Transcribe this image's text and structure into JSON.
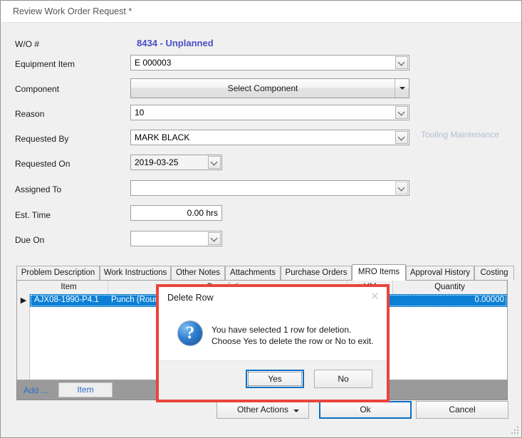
{
  "window": {
    "title": "Review Work Order Request *"
  },
  "form": {
    "wo_number": {
      "label": "W/O #",
      "value": "8434 - Unplanned",
      "color": "#4a4ec4"
    },
    "equipment_item": {
      "label": "Equipment Item",
      "value": "E 000003"
    },
    "component": {
      "label": "Component",
      "button_label": "Select Component"
    },
    "reason": {
      "label": "Reason",
      "value": "10",
      "hint": "Tooling Maintenance"
    },
    "requested_by": {
      "label": "Requested By",
      "value": "MARK BLACK"
    },
    "requested_on": {
      "label": "Requested On",
      "value": "2019-03-25"
    },
    "assigned_to": {
      "label": "Assigned To",
      "value": ""
    },
    "est_time": {
      "label": "Est. Time",
      "value": "0.00 hrs"
    },
    "due_on": {
      "label": "Due On",
      "value": ""
    }
  },
  "tabs": [
    {
      "label": "Problem Description",
      "selected": false
    },
    {
      "label": "Work Instructions",
      "selected": false
    },
    {
      "label": "Other Notes",
      "selected": false
    },
    {
      "label": "Attachments",
      "selected": false
    },
    {
      "label": "Purchase Orders",
      "selected": false
    },
    {
      "label": "MRO Items",
      "selected": true
    },
    {
      "label": "Approval History",
      "selected": false
    },
    {
      "label": "Costing",
      "selected": false
    }
  ],
  "grid": {
    "columns": [
      "Item",
      "Description",
      "UM",
      "Quantity"
    ],
    "row_indicator": "▶",
    "rows": [
      {
        "item": "AJX08-1990-P4.1",
        "description": "Punch (Round)",
        "um": "",
        "quantity": "0.00000"
      }
    ],
    "footer": {
      "add_label": "Add ...",
      "item_button_label": "Item"
    }
  },
  "bottom_bar": {
    "other_actions": "Other Actions",
    "ok": "Ok",
    "cancel": "Cancel"
  },
  "dialog": {
    "title": "Delete Row",
    "close_icon": "close-icon",
    "icon": "question-icon",
    "icon_glyph": "?",
    "message_line1": "You have selected 1 row for deletion.",
    "message_line2": "Choose Yes to delete the row or No to exit.",
    "yes_label": "Yes",
    "no_label": "No",
    "highlight_color": "#e8453c"
  }
}
